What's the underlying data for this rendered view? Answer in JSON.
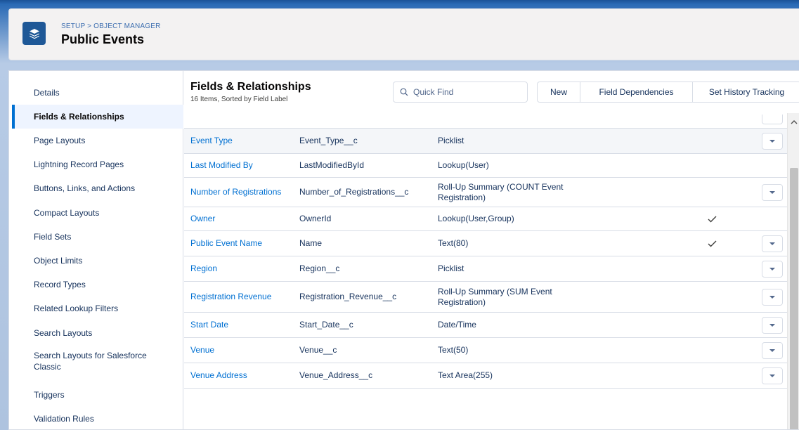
{
  "header": {
    "breadcrumb": "SETUP > OBJECT MANAGER",
    "title": "Public Events",
    "icon": "layers-icon"
  },
  "sidebar": {
    "items": [
      {
        "label": "Details"
      },
      {
        "label": "Fields & Relationships",
        "active": true
      },
      {
        "label": "Page Layouts"
      },
      {
        "label": "Lightning Record Pages"
      },
      {
        "label": "Buttons, Links, and Actions"
      },
      {
        "label": "Compact Layouts"
      },
      {
        "label": "Field Sets"
      },
      {
        "label": "Object Limits"
      },
      {
        "label": "Record Types"
      },
      {
        "label": "Related Lookup Filters"
      },
      {
        "label": "Search Layouts"
      },
      {
        "label": "Search Layouts for Salesforce Classic"
      },
      {
        "label": "Triggers"
      },
      {
        "label": "Validation Rules"
      }
    ]
  },
  "main": {
    "title": "Fields & Relationships",
    "subtitle": "16 Items, Sorted by Field Label",
    "quick_find_placeholder": "Quick Find",
    "buttons": {
      "new": "New",
      "field_dependencies": "Field Dependencies",
      "history": "Set History Tracking"
    }
  },
  "fields": [
    {
      "label": "Event Type",
      "api": "Event_Type__c",
      "type": "Picklist",
      "indexed": false,
      "menu": true
    },
    {
      "label": "Last Modified By",
      "api": "LastModifiedById",
      "type": "Lookup(User)",
      "indexed": false,
      "menu": false
    },
    {
      "label": "Number of Registrations",
      "api": "Number_of_Registrations__c",
      "type": "Roll-Up Summary (COUNT Event Registration)",
      "indexed": false,
      "menu": true
    },
    {
      "label": "Owner",
      "api": "OwnerId",
      "type": "Lookup(User,Group)",
      "indexed": true,
      "menu": false
    },
    {
      "label": "Public Event Name",
      "api": "Name",
      "type": "Text(80)",
      "indexed": true,
      "menu": true
    },
    {
      "label": "Region",
      "api": "Region__c",
      "type": "Picklist",
      "indexed": false,
      "menu": true
    },
    {
      "label": "Registration Revenue",
      "api": "Registration_Revenue__c",
      "type": "Roll-Up Summary (SUM Event Registration)",
      "indexed": false,
      "menu": true
    },
    {
      "label": "Start Date",
      "api": "Start_Date__c",
      "type": "Date/Time",
      "indexed": false,
      "menu": true
    },
    {
      "label": "Venue",
      "api": "Venue__c",
      "type": "Text(50)",
      "indexed": false,
      "menu": true
    },
    {
      "label": "Venue Address",
      "api": "Venue_Address__c",
      "type": "Text Area(255)",
      "indexed": false,
      "menu": true
    }
  ],
  "colors": {
    "link": "#0070d2",
    "header_icon": "#1e5897",
    "active_nav": "#eef4ff"
  }
}
